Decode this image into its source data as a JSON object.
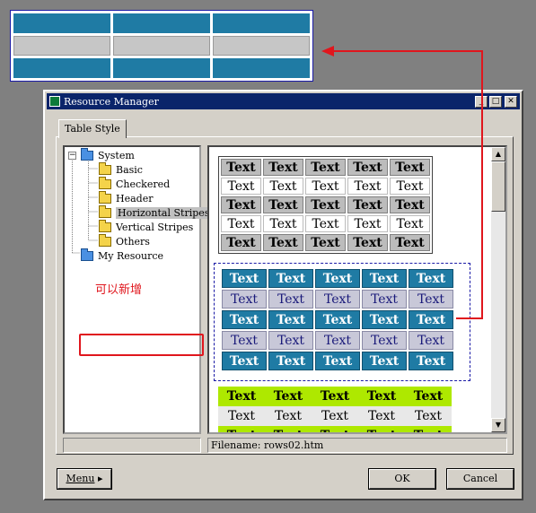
{
  "window": {
    "title": "Resource Manager",
    "controls": [
      "_",
      "□",
      "✕"
    ]
  },
  "tab": {
    "label": "Table Style"
  },
  "tree": {
    "root": "System",
    "children": [
      "Basic",
      "Checkered",
      "Header",
      "Horizontal Stripes",
      "Vertical Stripes",
      "Others"
    ],
    "selected": "Horizontal Stripes",
    "extra": "My Resource"
  },
  "annotation": {
    "text": "可以新增"
  },
  "tables": {
    "cell_text": "Text"
  },
  "status": {
    "filename": "Filename: rows02.htm"
  },
  "buttons": {
    "menu": "Menu",
    "ok": "OK",
    "cancel": "Cancel"
  },
  "colors": {
    "stripe_blue": "#1f7ba4",
    "lime": "#aee800",
    "annotation_red": "#e0161d",
    "title_bar": "#0a246a"
  }
}
